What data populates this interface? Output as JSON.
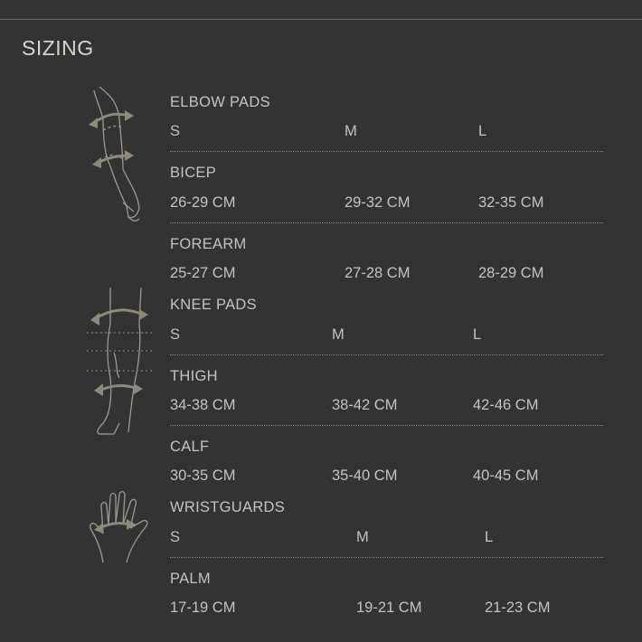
{
  "page": {
    "title": "SIZING"
  },
  "sections": [
    {
      "title": "ELBOW PADS",
      "sizes": [
        "S",
        "M",
        "L"
      ],
      "rows": [
        {
          "label": "BICEP",
          "values": [
            "26-29 CM",
            "29-32 CM",
            "32-35 CM"
          ]
        },
        {
          "label": "FOREARM",
          "values": [
            "25-27 CM",
            "27-28 CM",
            "28-29 CM"
          ]
        }
      ]
    },
    {
      "title": "KNEE PADS",
      "sizes": [
        "S",
        "M",
        "L"
      ],
      "rows": [
        {
          "label": "THIGH",
          "values": [
            "34-38 CM",
            "38-42 CM",
            "42-46 CM"
          ]
        },
        {
          "label": "CALF",
          "values": [
            "30-35 CM",
            "35-40 CM",
            "40-45 CM"
          ]
        }
      ]
    },
    {
      "title": "WRISTGUARDS",
      "sizes": [
        "S",
        "M",
        "L"
      ],
      "rows": [
        {
          "label": "PALM",
          "values": [
            "17-19 CM",
            "19-21 CM",
            "21-23 CM"
          ]
        }
      ]
    }
  ],
  "icons": {
    "elbow": "arm-measurement-icon",
    "knee": "leg-measurement-icon",
    "wrist": "hand-measurement-icon"
  },
  "colors": {
    "background": "#333333",
    "text": "#c4c4bd",
    "accent": "#8e8a78"
  }
}
